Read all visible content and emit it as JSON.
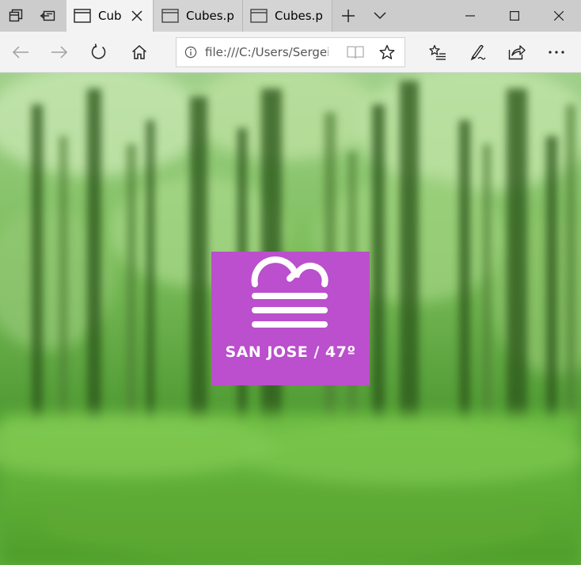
{
  "browser": {
    "tabs": [
      {
        "title": "Cub",
        "active": true
      },
      {
        "title": "Cubes.ps",
        "active": false
      },
      {
        "title": "Cubes.ps",
        "active": false
      }
    ],
    "address": {
      "url": "file:///C:/Users/Sergei"
    },
    "icons": {
      "tab_aside": "tab-aside-icon",
      "tab_back": "tab-back-icon",
      "page": "page-icon",
      "close": "close-icon",
      "new_tab": "plus-icon",
      "tab_list": "chevron-down-icon",
      "minimize": "minimize-icon",
      "maximize": "maximize-icon",
      "window_close": "window-close-icon",
      "back": "back-arrow-icon",
      "forward": "forward-arrow-icon",
      "refresh": "refresh-icon",
      "home": "home-icon",
      "info": "info-icon",
      "reading_view": "reading-view-icon",
      "favorite": "star-icon",
      "favorites_hub": "favorites-list-icon",
      "notes": "pen-icon",
      "share": "share-icon",
      "more": "more-icon"
    },
    "colors": {
      "tab_bar": "#cccccc",
      "toolbar": "#f3f3f3"
    }
  },
  "weather": {
    "label": "SAN JOSE / 47º",
    "icon": "fog-cloud-icon",
    "tile_color": "#bb4fcd"
  }
}
